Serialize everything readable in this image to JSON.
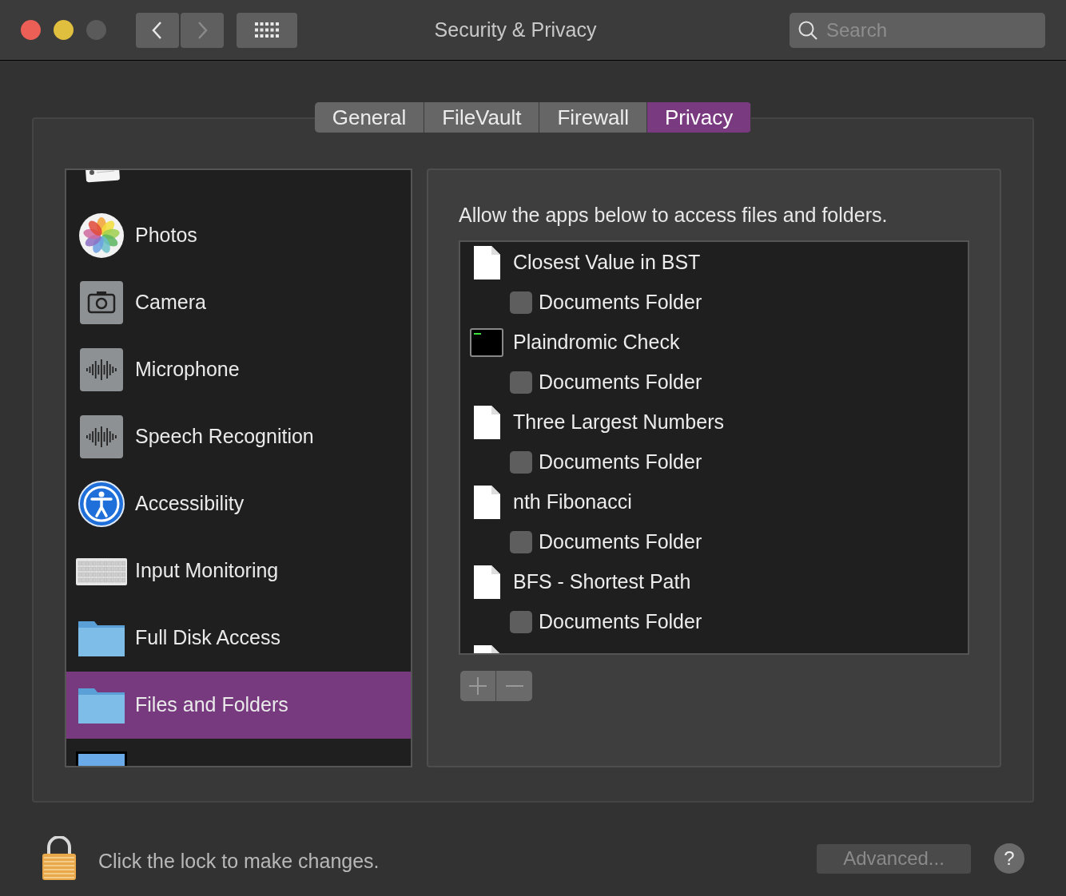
{
  "window": {
    "title": "Security & Privacy"
  },
  "nav_buttons": [
    {
      "kind": "back",
      "disabled": false
    },
    {
      "kind": "forward",
      "disabled": true
    }
  ],
  "search": {
    "placeholder": "Search"
  },
  "tabs": [
    {
      "label": "General",
      "selected": false
    },
    {
      "label": "FileVault",
      "selected": false
    },
    {
      "label": "Firewall",
      "selected": false
    },
    {
      "label": "Privacy",
      "selected": true
    }
  ],
  "sidebar": {
    "items": [
      {
        "selected": false
      },
      {
        "label": "Photos",
        "selected": false
      },
      {
        "label": "Camera",
        "selected": false
      },
      {
        "label": "Microphone",
        "selected": false
      },
      {
        "label": "Speech Recognition",
        "selected": false
      },
      {
        "label": "Accessibility",
        "selected": false
      },
      {
        "label": "Input Monitoring",
        "selected": false
      },
      {
        "label": "Full Disk Access",
        "selected": false
      },
      {
        "label": "Files and Folders",
        "selected": true
      },
      {
        "selected": false
      }
    ]
  },
  "detail": {
    "heading": "Allow the apps below to access files and folders.",
    "apps": [
      {
        "kind": "document",
        "label": "Closest Value in BST"
      },
      {
        "kind": "folder",
        "label": "Documents Folder",
        "checked": false
      },
      {
        "kind": "program",
        "label": "Plaindromic Check"
      },
      {
        "kind": "folder",
        "label": "Documents Folder",
        "checked": false
      },
      {
        "kind": "document",
        "label": "Three Largest Numbers"
      },
      {
        "kind": "folder",
        "label": "Documents Folder",
        "checked": false
      },
      {
        "kind": "document",
        "label": "nth Fibonacci"
      },
      {
        "kind": "folder",
        "label": "Documents Folder",
        "checked": false
      },
      {
        "kind": "document",
        "label": "BFS - Shortest Path"
      },
      {
        "kind": "folder",
        "label": "Documents Folder",
        "checked": false
      },
      {
        "kind": "document"
      }
    ],
    "add_disabled": true,
    "remove_disabled": true
  },
  "footer": {
    "lock_text": "Click the lock to make changes.",
    "advanced": {
      "label": "Advanced...",
      "disabled": true
    },
    "help": "?"
  }
}
